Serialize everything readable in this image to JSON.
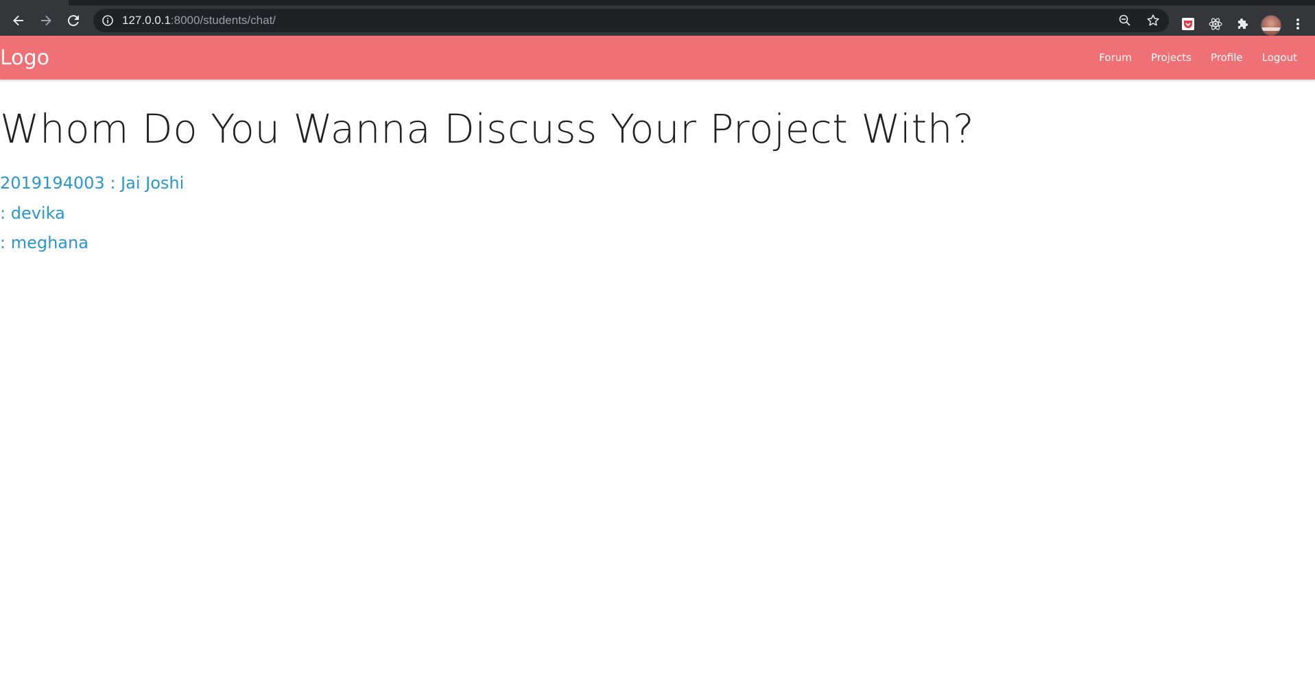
{
  "browser": {
    "url_host": "127.0.0.1",
    "url_path": ":8000/students/chat/",
    "icons": {
      "back": "back-arrow-icon",
      "forward": "forward-arrow-icon",
      "reload": "reload-icon",
      "site_info": "info-icon",
      "zoom": "zoom-out-icon",
      "bookmark": "star-icon",
      "ext_pocket": "pocket-icon",
      "ext_react": "react-icon",
      "extensions": "puzzle-icon",
      "menu": "kebab-menu-icon"
    }
  },
  "navbar": {
    "brand": "Logo",
    "links": [
      "Forum",
      "Projects",
      "Profile",
      "Logout"
    ],
    "background": "#f07175"
  },
  "main": {
    "title": "Whom Do You Wanna Discuss Your Project With?",
    "students": [
      "2019194003 : Jai Joshi",
      ": devika",
      ": meghana"
    ],
    "link_color": "#2a96d4"
  }
}
